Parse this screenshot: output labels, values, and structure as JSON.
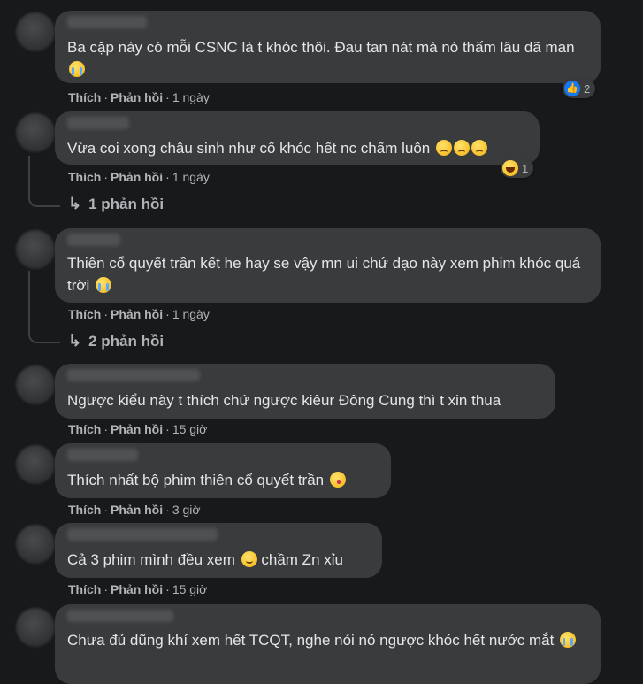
{
  "comments": [
    {
      "text": "Ba cặp này có mỗi CSNC là t khóc thôi. Đau tan nát mà nó thấm lâu dã man",
      "like": "Thích",
      "reply": "Phản hồi",
      "time": "1 ngày",
      "reaction_count": "2",
      "reaction": "like-icon"
    },
    {
      "text": "Vừa coi xong châu sinh như cố khóc hết nc chấm luôn",
      "like": "Thích",
      "reply": "Phản hồi",
      "time": "1 ngày",
      "reaction_count": "1",
      "reaction": "haha-icon",
      "replies_label": "1 phản hồi"
    },
    {
      "text": "Thiên cổ quyết trần kết he hay se vậy mn ui chứ dạo này xem phim khóc quá trời",
      "like": "Thích",
      "reply": "Phản hồi",
      "time": "1 ngày",
      "replies_label": "2 phản hồi"
    },
    {
      "text": "Ngược kiểu này t thích chứ ngược kiêur Đông Cung thì t xin thua",
      "like": "Thích",
      "reply": "Phản hồi",
      "time": "15 giờ"
    },
    {
      "text": "Thích nhất bộ phim thiên cổ quyết trần",
      "like": "Thích",
      "reply": "Phản hồi",
      "time": "3 giờ"
    },
    {
      "text": "Cả 3 phim mình đều xem",
      "text2": "chầm Zn xỉu",
      "like": "Thích",
      "reply": "Phản hồi",
      "time": "15 giờ"
    },
    {
      "text": "Chưa đủ dũng khí xem hết TCQT, nghe nói nó ngược khóc hết nước mắt"
    }
  ],
  "separator": "·",
  "reply_arrow": "↳",
  "colors": {
    "background": "#18191a",
    "bubble": "#3a3b3c",
    "text": "#e4e6eb",
    "meta": "#b0b3b8",
    "like": "#1877f2"
  }
}
